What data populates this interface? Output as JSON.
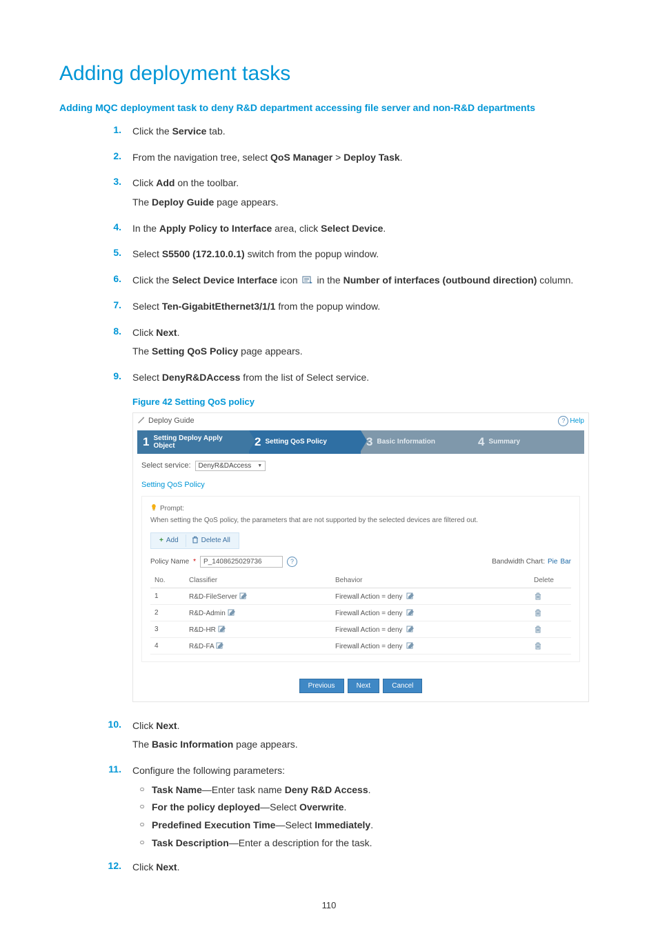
{
  "title": "Adding deployment tasks",
  "subtitle": "Adding MQC deployment task to deny R&D department accessing file server and non-R&D departments",
  "steps": {
    "s1_pre": "Click the ",
    "s1_b1": "Service",
    "s1_post": " tab.",
    "s2_pre": "From the navigation tree, select ",
    "s2_b1": "QoS Manager",
    "s2_sep": " > ",
    "s2_b2": "Deploy Task",
    "s2_post": ".",
    "s3_pre": "Click ",
    "s3_b1": "Add",
    "s3_post": " on the toolbar.",
    "s3b_pre": "The ",
    "s3b_b1": "Deploy Guide",
    "s3b_post": " page appears.",
    "s4_pre": "In the ",
    "s4_b1": "Apply Policy to Interface",
    "s4_mid": " area, click ",
    "s4_b2": "Select Device",
    "s4_post": ".",
    "s5_pre": "Select ",
    "s5_b1": "S5500 (172.10.0.1)",
    "s5_post": " switch from the popup window.",
    "s6_pre": "Click the ",
    "s6_b1": "Select Device Interface",
    "s6_mid1": " icon ",
    "s6_mid2": " in the ",
    "s6_b2": "Number of interfaces (outbound direction)",
    "s6_post": " column.",
    "s7_pre": "Select ",
    "s7_b1": "Ten-GigabitEthernet3/1/1",
    "s7_post": " from the popup window.",
    "s8_pre": "Click ",
    "s8_b1": "Next",
    "s8_post": ".",
    "s8b_pre": "The ",
    "s8b_b1": "Setting QoS Policy",
    "s8b_post": " page appears.",
    "s9_pre": "Select ",
    "s9_b1": "DenyR&DAccess",
    "s9_post": " from the list of Select service.",
    "s10_pre": "Click ",
    "s10_b1": "Next",
    "s10_post": ".",
    "s10b_pre": "The ",
    "s10b_b1": "Basic Information",
    "s10b_post": " page appears.",
    "s11": "Configure the following parameters:",
    "s12_pre": "Click ",
    "s12_b1": "Next",
    "s12_post": "."
  },
  "sub11": {
    "a_b": "Task Name",
    "a_mid": "—Enter task name ",
    "a_b2": "Deny R&D Access",
    "a_post": ".",
    "b_b": "For the policy deployed",
    "b_mid": "—Select ",
    "b_b2": "Overwrite",
    "b_post": ".",
    "c_b": "Predefined Execution Time",
    "c_mid": "—Select ",
    "c_b2": "Immediately",
    "c_post": ".",
    "d_b": "Task Description",
    "d_post": "—Enter a description for the task."
  },
  "nums": {
    "1": "1.",
    "2": "2.",
    "3": "3.",
    "4": "4.",
    "5": "5.",
    "6": "6.",
    "7": "7.",
    "8": "8.",
    "9": "9.",
    "10": "10.",
    "11": "11.",
    "12": "12."
  },
  "circ": "○",
  "figure_caption": "Figure 42 Setting QoS policy",
  "screenshot": {
    "breadcrumb": "Deploy Guide",
    "help": "Help",
    "wizard": {
      "s1": "Setting Deploy Apply Object",
      "s2": "Setting QoS Policy",
      "s3": "Basic Information",
      "s4": "Summary",
      "n1": "1",
      "n2": "2",
      "n3": "3",
      "n4": "4"
    },
    "select_service_label": "Select service:",
    "select_service_value": "DenyR&DAccess",
    "section_title": "Setting QoS Policy",
    "prompt_label": "Prompt:",
    "prompt_note": "When setting the QoS policy, the parameters that are not supported by the selected devices are filtered out.",
    "toolbar": {
      "add": "Add",
      "delete_all": "Delete All"
    },
    "policy_name_label": "Policy Name",
    "policy_name_value": "P_1408625029736",
    "bw_label": "Bandwidth Chart:",
    "bw_pie": "Pie",
    "bw_bar": "Bar",
    "table": {
      "headers": {
        "no": "No.",
        "classifier": "Classifier",
        "behavior": "Behavior",
        "delete": "Delete"
      },
      "behavior_value": "Firewall Action = deny",
      "rows": [
        {
          "no": "1",
          "classifier": "R&D-FileServer"
        },
        {
          "no": "2",
          "classifier": "R&D-Admin"
        },
        {
          "no": "3",
          "classifier": "R&D-HR"
        },
        {
          "no": "4",
          "classifier": "R&D-FA"
        }
      ]
    },
    "buttons": {
      "prev": "Previous",
      "next": "Next",
      "cancel": "Cancel"
    }
  },
  "page_number": "110"
}
